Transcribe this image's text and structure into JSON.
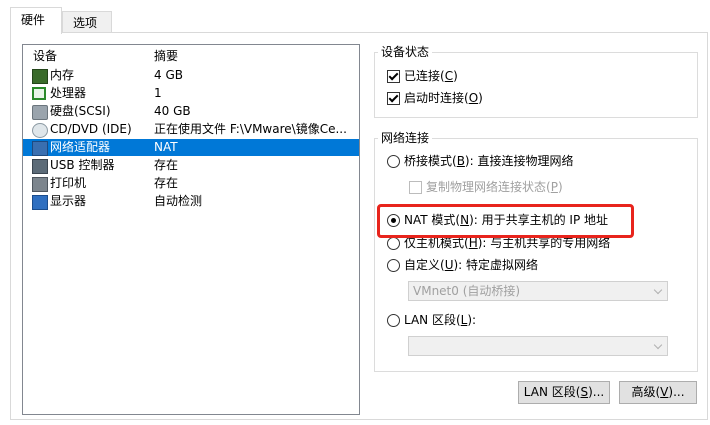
{
  "tabs": [
    {
      "label": "硬件"
    },
    {
      "label": "选项"
    }
  ],
  "device_list": {
    "headers": {
      "device": "设备",
      "summary": "摘要"
    },
    "rows": [
      {
        "icon": "memory-icon",
        "name": "内存",
        "summary": "4 GB"
      },
      {
        "icon": "processor-icon",
        "name": "处理器",
        "summary": "1"
      },
      {
        "icon": "hard-disk-icon",
        "name": "硬盘(SCSI)",
        "summary": "40 GB"
      },
      {
        "icon": "cd-dvd-icon",
        "name": "CD/DVD (IDE)",
        "summary": "正在使用文件 F:\\VMware\\镜像Ce..."
      },
      {
        "icon": "network-adapter-icon",
        "name": "网络适配器",
        "summary": "NAT"
      },
      {
        "icon": "usb-controller-icon",
        "name": "USB 控制器",
        "summary": "存在"
      },
      {
        "icon": "printer-icon",
        "name": "打印机",
        "summary": "存在"
      },
      {
        "icon": "display-icon",
        "name": "显示器",
        "summary": "自动检测"
      }
    ],
    "selected_index": 4,
    "selection_color": "#0078d7"
  },
  "device_status": {
    "title": "设备状态",
    "connected": {
      "label_pre": "已连接(",
      "key": "C",
      "label_post": ")",
      "checked": true
    },
    "connect_at_power_on": {
      "label_pre": "启动时连接(",
      "key": "O",
      "label_post": ")",
      "checked": true
    }
  },
  "network_connection": {
    "title": "网络连接",
    "bridged": {
      "label_pre": "桥接模式(",
      "key": "B",
      "label_post": "): 直接连接物理网络",
      "selected": false
    },
    "replicate": {
      "label_pre": "复制物理网络连接状态(",
      "key": "P",
      "label_post": ")",
      "checked": false,
      "enabled": false
    },
    "nat": {
      "label_pre": "NAT 模式(",
      "key": "N",
      "label_post": "): 用于共享主机的 IP 地址",
      "selected": true
    },
    "host_only": {
      "label_pre": "仅主机模式(",
      "key": "H",
      "label_post": "): 与主机共享的专用网络",
      "selected": false
    },
    "custom": {
      "label_pre": "自定义(",
      "key": "U",
      "label_post": "): 特定虚拟网络",
      "selected": false
    },
    "custom_select_value": "VMnet0 (自动桥接)",
    "lan_segment": {
      "label_pre": "LAN 区段(",
      "key": "L",
      "label_post": "):",
      "selected": false
    },
    "lan_select_value": ""
  },
  "buttons": {
    "lan_segments": {
      "label_pre": "LAN 区段(",
      "key": "S",
      "label_post": ")..."
    },
    "advanced": {
      "label_pre": "高级(",
      "key": "V",
      "label_post": ")..."
    }
  },
  "highlight_color": "#e8241c"
}
